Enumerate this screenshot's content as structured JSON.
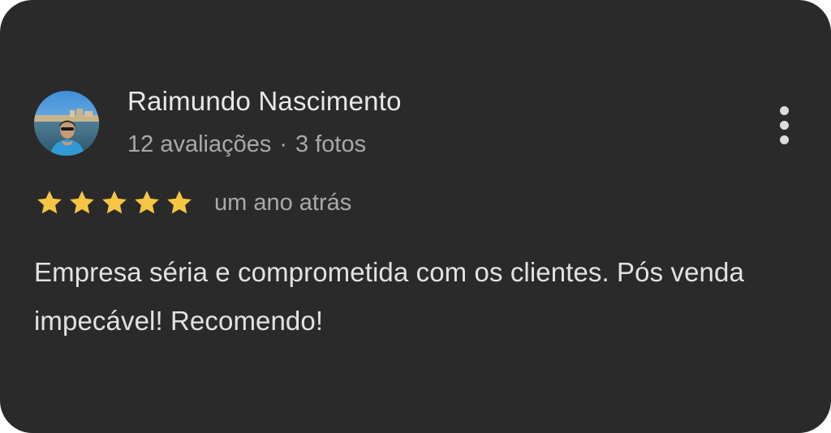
{
  "reviewer": {
    "name": "Raimundo Nascimento",
    "reviews_count": "12 avaliações",
    "separator": "·",
    "photos_count": "3 fotos"
  },
  "rating": {
    "stars": 5,
    "max_stars": 5,
    "star_color": "#f6c544",
    "time_ago": "um ano atrás"
  },
  "review": {
    "text": "Empresa séria e comprometida com os clientes. Pós venda impecável! Recomendo!"
  },
  "menu": {
    "icon": "more-vert-icon"
  },
  "colors": {
    "card_background": "#2a2a2a",
    "primary_text": "#e8e8e8",
    "secondary_text": "#a9a9a9"
  }
}
